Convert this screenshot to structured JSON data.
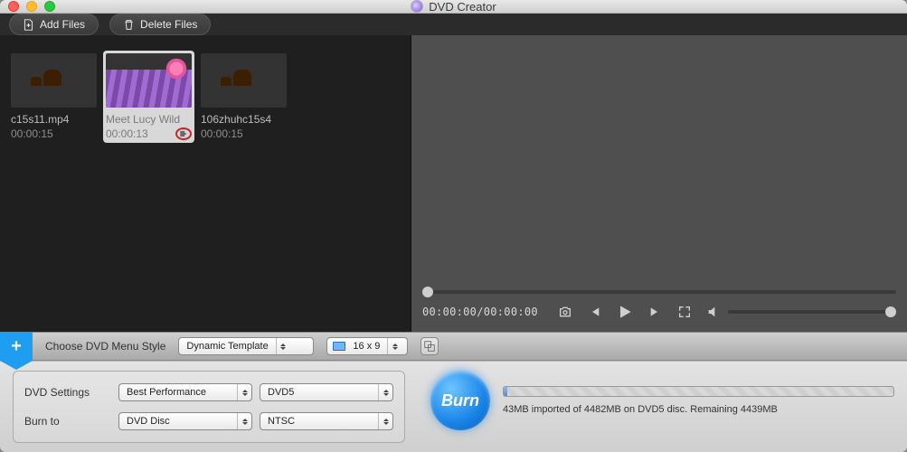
{
  "titlebar": {
    "title": "DVD Creator"
  },
  "toolbar": {
    "add_label": "Add Files",
    "delete_label": "Delete Files"
  },
  "files": [
    {
      "name": "c15s11.mp4",
      "duration": "00:00:15",
      "selected": false,
      "art": "camel",
      "edit": false
    },
    {
      "name": "Meet Lucy Wild",
      "duration": "00:00:13",
      "selected": true,
      "art": "flowers",
      "edit": true
    },
    {
      "name": "106zhuhc15s4",
      "duration": "00:00:15",
      "selected": false,
      "art": "camel",
      "edit": false
    }
  ],
  "player": {
    "timecode": "00:00:00/00:00:00"
  },
  "menu_strip": {
    "label": "Choose DVD Menu Style",
    "template": "Dynamic Template",
    "aspect": "16 x 9"
  },
  "settings": {
    "dvd_label": "DVD Settings",
    "burnto_label": "Burn to",
    "performance": "Best Performance",
    "disc_type": "DVD5",
    "burn_target": "DVD Disc",
    "tv_standard": "NTSC"
  },
  "burn": {
    "label": "Burn"
  },
  "status": {
    "text": "43MB imported of 4482MB on DVD5 disc. Remaining 4439MB",
    "percent": 1
  }
}
